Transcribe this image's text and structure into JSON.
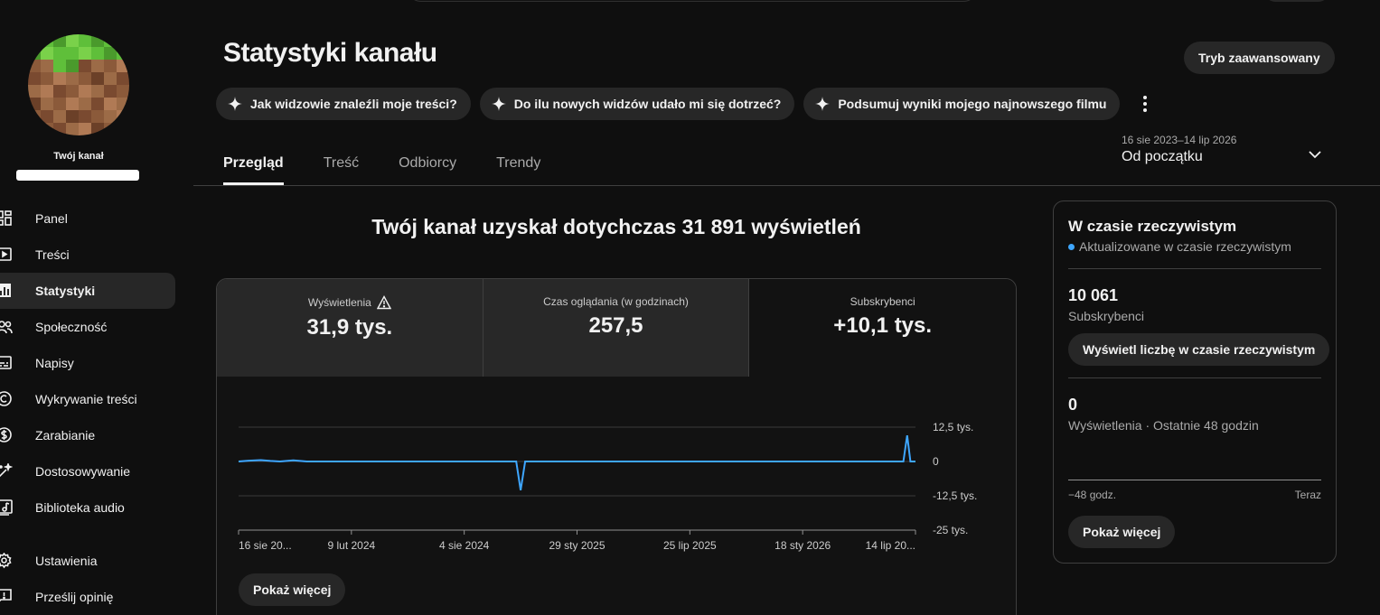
{
  "sidebar": {
    "channel_label": "Twój kanał",
    "items": [
      {
        "label": "Panel",
        "icon": "dashboard-icon"
      },
      {
        "label": "Treści",
        "icon": "content-icon"
      },
      {
        "label": "Statystyki",
        "icon": "analytics-icon",
        "active": true
      },
      {
        "label": "Społeczność",
        "icon": "community-icon"
      },
      {
        "label": "Napisy",
        "icon": "subtitles-icon"
      },
      {
        "label": "Wykrywanie treści",
        "icon": "copyright-icon"
      },
      {
        "label": "Zarabianie",
        "icon": "dollar-icon"
      },
      {
        "label": "Dostosowywanie",
        "icon": "magic-wand-icon"
      },
      {
        "label": "Biblioteka audio",
        "icon": "audio-library-icon"
      }
    ],
    "bottom_items": [
      {
        "label": "Ustawienia",
        "icon": "gear-icon"
      },
      {
        "label": "Prześlij opinię",
        "icon": "feedback-icon"
      }
    ]
  },
  "header": {
    "title": "Statystyki kanału",
    "advanced_button": "Tryb zaawansowany",
    "chips": [
      "Jak widzowie znaleźli moje treści?",
      "Do ilu nowych widzów udało mi się dotrzeć?",
      "Podsumuj wyniki mojego najnowszego filmu"
    ],
    "tabs": [
      "Przegląd",
      "Treść",
      "Odbiorcy",
      "Trendy"
    ],
    "active_tab": 0,
    "date_range": "16 sie 2023–14 lip 2026",
    "date_range_label": "Od początku"
  },
  "main": {
    "heading": "Twój kanał uzyskał dotychczas 31 891 wyświetleń",
    "metrics": [
      {
        "label": "Wyświetlenia",
        "value": "31,9 tys.",
        "warning": true
      },
      {
        "label": "Czas oglądania (w godzinach)",
        "value": "257,5"
      },
      {
        "label": "Subskrybenci",
        "value": "+10,1 tys.",
        "selected": true
      }
    ],
    "show_more": "Pokaż więcej"
  },
  "chart_data": {
    "type": "line",
    "x_tick_labels": [
      "16 sie 20...",
      "9 lut 2024",
      "4 sie 2024",
      "29 sty 2025",
      "25 lip 2025",
      "18 sty 2026",
      "14 lip 20..."
    ],
    "y_tick_labels": [
      "12,5 tys.",
      "0",
      "-12,5 tys.",
      "-25 tys."
    ],
    "ylim": [
      -25000,
      12500
    ],
    "series": [
      {
        "color": "#3ea6ff",
        "points": [
          [
            "2023-08-16",
            0
          ],
          [
            "2023-09-01",
            300
          ],
          [
            "2023-09-20",
            500
          ],
          [
            "2023-10-05",
            200
          ],
          [
            "2023-10-20",
            0
          ],
          [
            "2023-11-10",
            400
          ],
          [
            "2023-12-01",
            0
          ],
          [
            "2024-08-04",
            0
          ],
          [
            "2024-10-25",
            0
          ],
          [
            "2024-11-01",
            -10500
          ],
          [
            "2024-11-08",
            0
          ],
          [
            "2026-06-25",
            0
          ],
          [
            "2026-07-01",
            9500
          ],
          [
            "2026-07-06",
            0
          ],
          [
            "2026-07-14",
            0
          ]
        ]
      }
    ],
    "grid": true
  },
  "realtime": {
    "title": "W czasie rzeczywistym",
    "subtitle": "Aktualizowane w czasie rzeczywistym",
    "subs_value": "10 061",
    "subs_label": "Subskrybenci",
    "live_button": "Wyświetl liczbę w czasie rzeczywistym",
    "views_value": "0",
    "views_label": "Wyświetlenia · Ostatnie 48 godzin",
    "axis_start": "−48 godz.",
    "axis_end": "Teraz",
    "show_more": "Pokaż więcej"
  },
  "colors": {
    "accent": "#3ea6ff",
    "background": "#0f0f0f",
    "chip": "#272727"
  }
}
